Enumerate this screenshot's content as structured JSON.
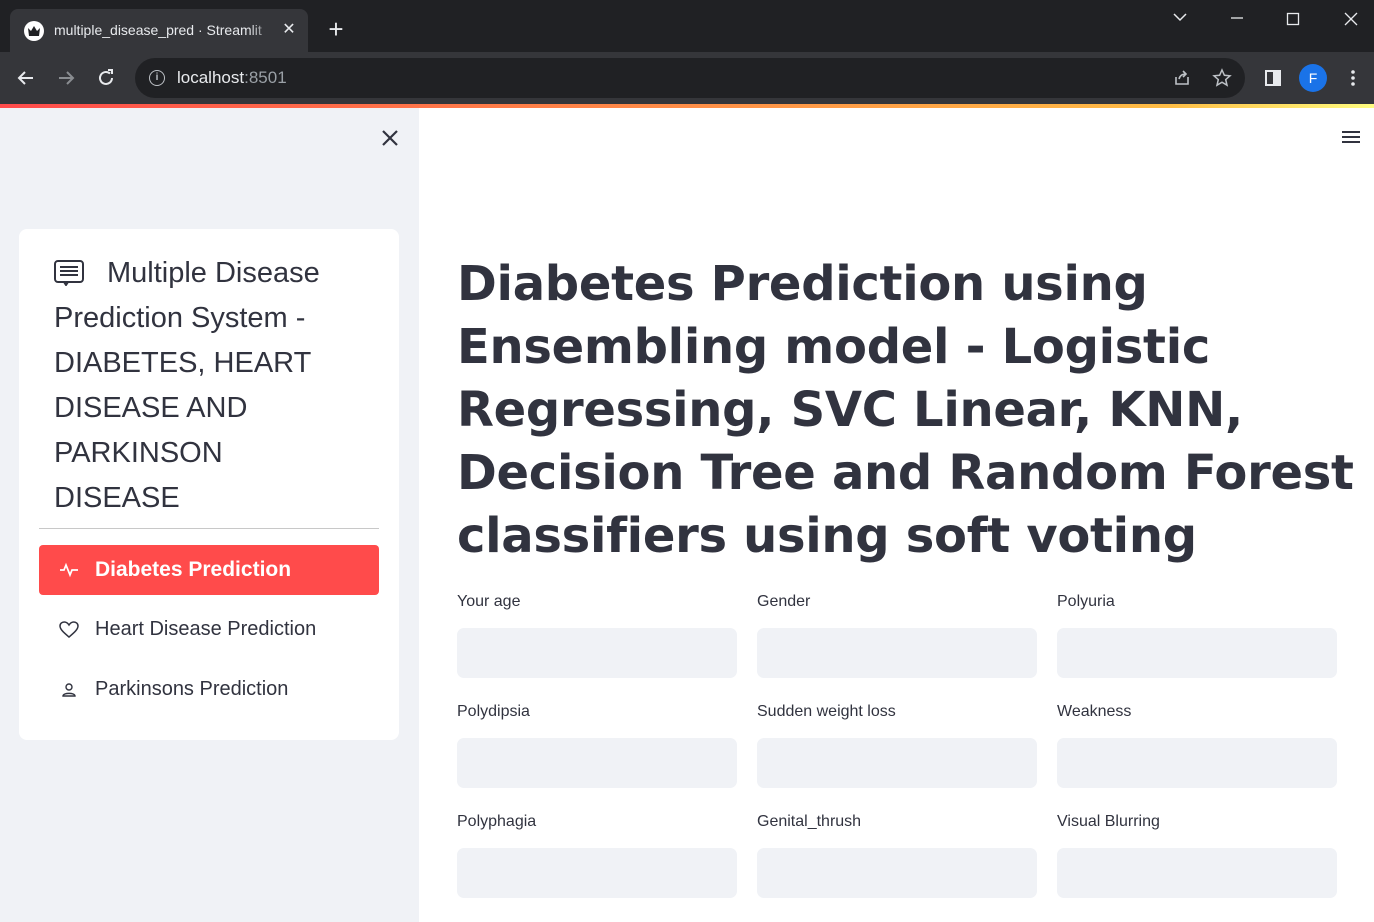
{
  "browser": {
    "tab_title": "multiple_disease_pred · Streamlit",
    "url_host": "localhost",
    "url_port": ":8501",
    "profile_initial": "F"
  },
  "sidebar": {
    "title": "Multiple Disease Prediction System - DIABETES, HEART DISEASE AND PARKINSON DISEASE",
    "items": [
      {
        "label": "Diabetes Prediction",
        "icon": "activity-icon",
        "active": true
      },
      {
        "label": "Heart Disease Prediction",
        "icon": "heart-icon",
        "active": false
      },
      {
        "label": "Parkinsons Prediction",
        "icon": "person-icon",
        "active": false
      }
    ]
  },
  "main": {
    "title": "Diabetes Prediction using Ensembling model - Logistic Regressing, SVC Linear, KNN, Decision Tree and Random Forest classifiers using soft voting",
    "fields": [
      {
        "label": "Your age",
        "value": ""
      },
      {
        "label": "Gender",
        "value": ""
      },
      {
        "label": "Polyuria",
        "value": ""
      },
      {
        "label": "Polydipsia",
        "value": ""
      },
      {
        "label": "Sudden weight loss",
        "value": ""
      },
      {
        "label": "Weakness",
        "value": ""
      },
      {
        "label": "Polyphagia",
        "value": ""
      },
      {
        "label": "Genital_thrush",
        "value": ""
      },
      {
        "label": "Visual Blurring",
        "value": ""
      }
    ]
  },
  "colors": {
    "accent": "#ff4b4b",
    "sidebar_bg": "#f0f2f6",
    "input_bg": "#f0f2f6",
    "text": "#31333f"
  }
}
